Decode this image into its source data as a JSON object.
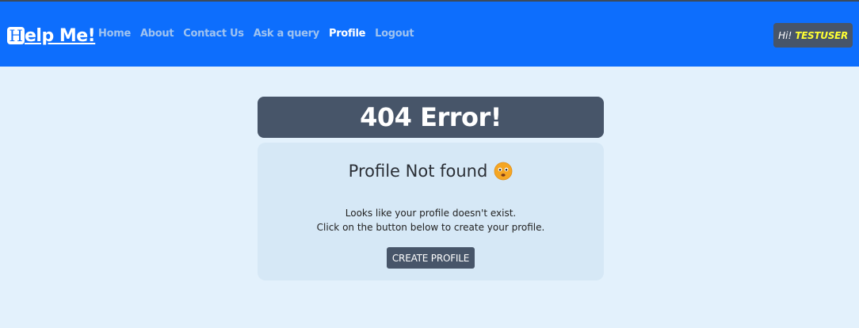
{
  "navbar": {
    "brand_letter": "H",
    "brand_rest": "elp Me!",
    "links": [
      {
        "label": "Home"
      },
      {
        "label": "About"
      },
      {
        "label": "Contact Us"
      },
      {
        "label": "Ask a query"
      },
      {
        "label": "Profile",
        "active": true
      },
      {
        "label": "Logout"
      }
    ],
    "greeting": "Hi!",
    "username": "TESTUSER",
    "accent": "#0d6efd"
  },
  "error": {
    "heading": "404 Error!",
    "title": "Profile Not found",
    "emoji_icon": "sad-face-icon",
    "line1": "Looks like your profile doesn't exist.",
    "line2": "Click on the button below to create your profile.",
    "button_label": "CREATE PROFILE"
  }
}
